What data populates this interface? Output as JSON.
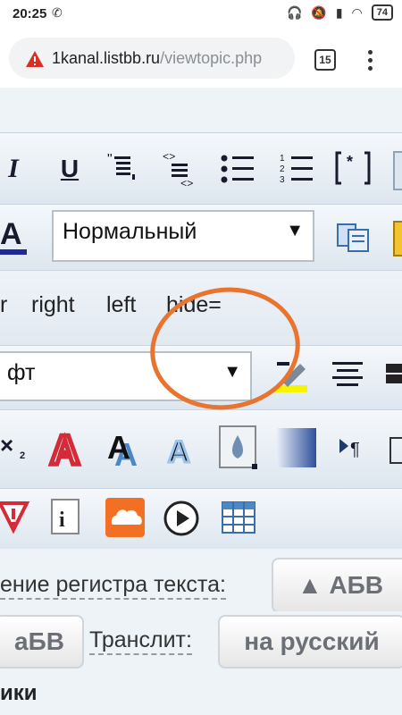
{
  "status_bar": {
    "time": "20:25",
    "battery": "74"
  },
  "browser": {
    "url_host": "1kanal.listbb.ru",
    "url_path": "/viewtopic.php",
    "tab_count": "15"
  },
  "toolbar": {
    "italic": "I",
    "underline": "U",
    "font_size_select": "Нормальный",
    "link_items": [
      "r",
      "right",
      "left",
      "hide="
    ],
    "font_select": "фт"
  },
  "case_row": {
    "label": "ение регистра текста:",
    "upper_button": "▲ АБВ",
    "lower_button": "аБВ"
  },
  "translit_row": {
    "label": "Транслит:",
    "button": "на русский"
  },
  "footer_text": "ики",
  "colors": {
    "annotation_circle": "#e8742f",
    "toolbar_bg": "#e7edf3"
  }
}
